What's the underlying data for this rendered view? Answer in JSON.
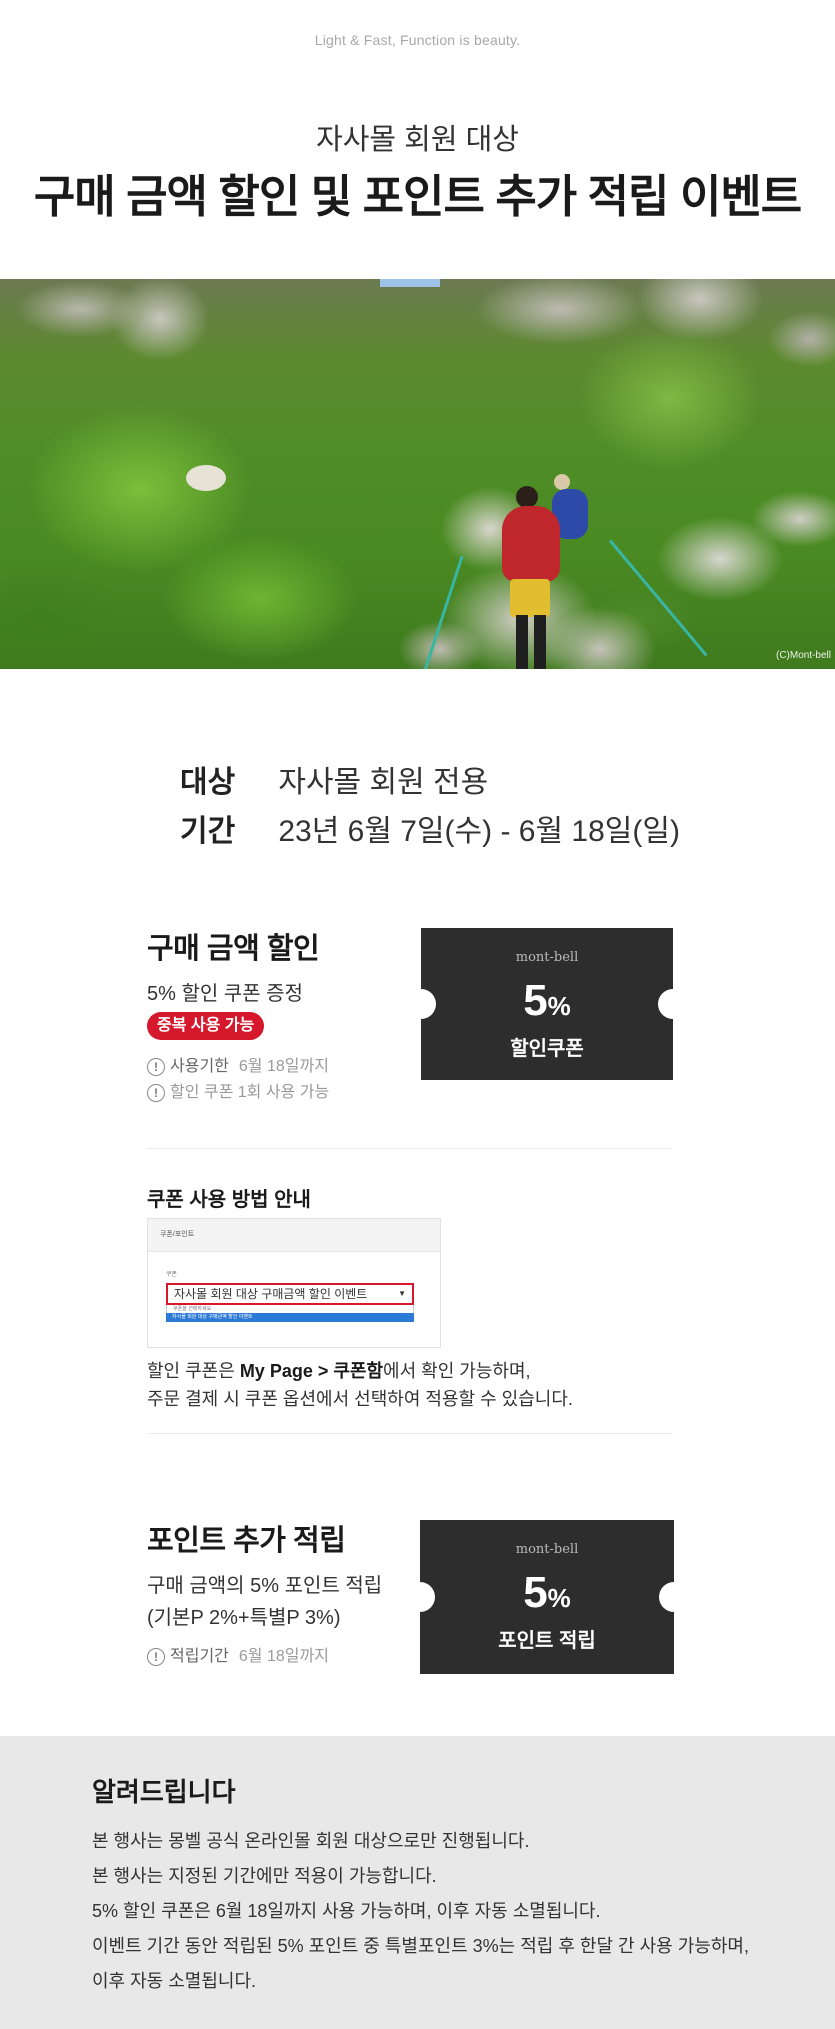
{
  "header": {
    "tagline": "Light & Fast, Function is beauty.",
    "subtitle": "자사몰 회원 대상",
    "title": "구매 금액 할인 및 포인트 추가 적립 이벤트"
  },
  "hero": {
    "copyright": "(C)Mont-bell"
  },
  "info": {
    "target_label": "대상",
    "target_value": "자사몰 회원 전용",
    "period_label": "기간",
    "period_value": "23년 6월 7일(수) - 6월 18일(일)"
  },
  "discount": {
    "title": "구매 금액 할인",
    "desc": "5% 할인 쿠폰 증정",
    "badge": "중복 사용 가능",
    "notes": [
      {
        "label": "사용기한",
        "value": "6월 18일까지"
      },
      {
        "label": "",
        "value": "할인 쿠폰 1회 사용 가능"
      }
    ],
    "ticket": {
      "brand": "mont-bell",
      "number": "5",
      "unit": "%",
      "caption": "할인쿠폰"
    }
  },
  "guide": {
    "title": "쿠폰 사용 방법 안내",
    "mock": {
      "header": "쿠폰/포인트",
      "field_label": "쿠폰",
      "selected": "자사몰 회원 대상 구매금액 할인 이벤트",
      "option_placeholder": "쿠폰을 선택하세요",
      "option_highlighted": "자사몰 회원 대상 구매금액 할인 이벤트"
    },
    "line1_pre": "할인 쿠폰은 ",
    "line1_bold": "My Page > 쿠폰함",
    "line1_post": "에서 확인 가능하며,",
    "line2": "주문 결제 시 쿠폰 옵션에서 선택하여 적용할 수 있습니다."
  },
  "points": {
    "title": "포인트 추가 적립",
    "line1": "구매 금액의 5% 포인트 적립",
    "line2": "(기본P 2%+특별P 3%)",
    "note_label": "적립기간",
    "note_value": "6월 18일까지",
    "ticket": {
      "brand": "mont-bell",
      "number": "5",
      "unit": "%",
      "caption": "포인트 적립"
    }
  },
  "notice": {
    "title": "알려드립니다",
    "items": [
      "본 행사는 몽벨 공식 온라인몰 회원 대상으로만 진행됩니다.",
      "본 행사는 지정된 기간에만 적용이 가능합니다.",
      "5% 할인 쿠폰은 6월 18일까지 사용 가능하며, 이후 자동 소멸됩니다.",
      "이벤트 기간 동안 적립된 5% 포인트 중 특별포인트 3%는 적립 후 한달 간 사용 가능하며,",
      "이후 자동 소멸됩니다."
    ]
  },
  "colors": {
    "accent": "#d6182d",
    "ticket": "#2d2d2d",
    "notice_bg": "#e8e8e8"
  }
}
